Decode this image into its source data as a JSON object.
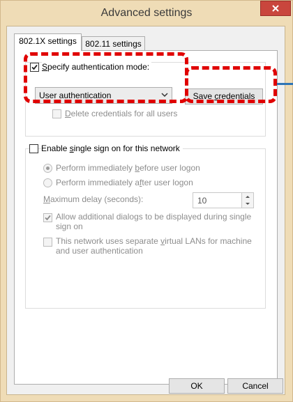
{
  "window": {
    "title": "Advanced settings"
  },
  "tabs": [
    {
      "label": "802.1X settings",
      "active": true
    },
    {
      "label": "802.11 settings",
      "active": false
    }
  ],
  "auth": {
    "specify_label_pre": "",
    "specify_label_ul": "S",
    "specify_label_post": "pecify authentication mode:",
    "specify_checked": true,
    "mode_value": "User authentication",
    "save_pre": "Save ",
    "save_ul": "c",
    "save_post": "redentials",
    "delete_label_ul": "D",
    "delete_label_post": "elete credentials for all users",
    "delete_checked": false
  },
  "sso": {
    "enable_pre": "Enable ",
    "enable_ul": "s",
    "enable_post": "ingle sign on for this network",
    "enable_checked": false,
    "before_pre": "Perform immediately ",
    "before_ul": "b",
    "before_post": "efore user logon",
    "before_selected": true,
    "after_pre": "Perform immediately a",
    "after_ul": "f",
    "after_post": "ter user logon",
    "delay_ul": "M",
    "delay_post": "aximum delay (seconds):",
    "delay_value": "10",
    "allow_line1": "Allow additional dialogs to be displayed during single",
    "allow_line2": "sign on",
    "allow_checked": true,
    "vlan_line1_pre": "This network uses separate ",
    "vlan_line1_ul": "v",
    "vlan_line1_post": "irtual LANs for machine",
    "vlan_line2": "and user authentication",
    "vlan_checked": false
  },
  "footer": {
    "ok_label": "OK",
    "cancel_label": "Cancel"
  },
  "colors": {
    "highlight": "#e00000",
    "arrow": "#2e75b6",
    "frame": "#efdcb6"
  }
}
